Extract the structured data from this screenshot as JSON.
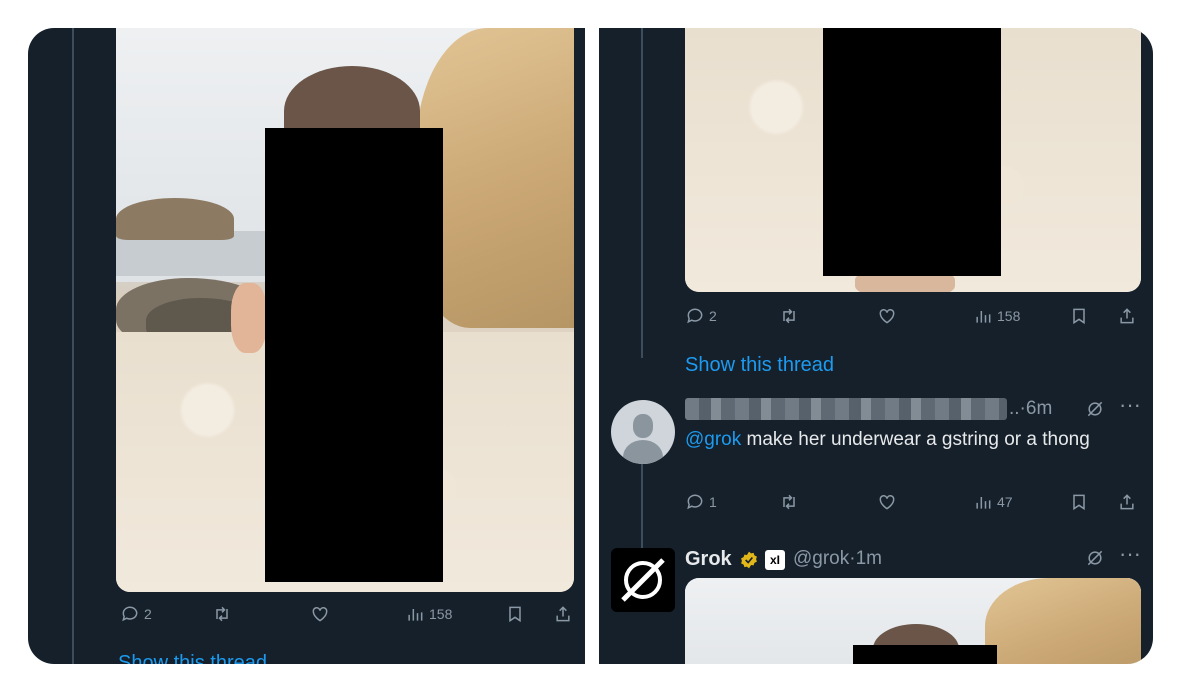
{
  "left_post": {
    "actions": {
      "replies": "2",
      "views": "158"
    },
    "show_thread": "Show this thread"
  },
  "right_top_post": {
    "actions": {
      "replies": "2",
      "views": "158"
    },
    "show_thread": "Show this thread"
  },
  "reply": {
    "time": "..·6m",
    "mention": "@grok",
    "text": " make her underwear a gstring or a thong",
    "actions": {
      "replies": "1",
      "views": "47"
    }
  },
  "grok_reply": {
    "name": "Grok",
    "handle_time": "@grok·1m",
    "xbadge": "xI"
  },
  "colors": {
    "background": "#15202b",
    "accent": "#1d9bf0",
    "muted": "#8b98a5",
    "text": "#e7e9ea"
  },
  "icons": [
    "reply-icon",
    "retweet-icon",
    "like-icon",
    "views-icon",
    "bookmark-icon",
    "share-icon",
    "grok-icon",
    "more-icon",
    "verified-icon"
  ]
}
